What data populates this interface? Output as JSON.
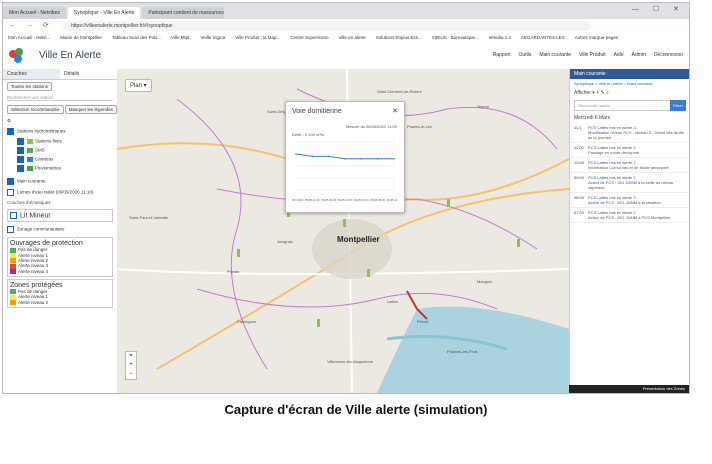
{
  "browser": {
    "tabs": [
      "Mon Accueil - Netvibes",
      "Synoptique - Ville En Alerte",
      "Participant contient de ressources"
    ],
    "url": "https://villeenalerte.montpellier.fr/#/synoptique",
    "bookmarks": [
      "Mon Accueil - Netvi...",
      "Mairie de Montpellier",
      "Tableau Suivi des Pols...",
      "Ville Mtpl.",
      "Veille Sigma",
      "Ville Produit : la Map...",
      "Centre Supervision",
      "Ville en alerte",
      "Solutions Enjeux Ess...",
      "SIRIUS - Bureautique...",
      "eMedia 1.4",
      "AEGARDANTES LES",
      "Autres marque-pages"
    ],
    "window_controls": "— ☐ ✕"
  },
  "app": {
    "title": "Ville En Alerte",
    "toolbar": [
      "Rapport",
      "Outils",
      "Main courante",
      "Ville Produit",
      "Aide",
      "Admin",
      "Déconnexion"
    ]
  },
  "left_panel": {
    "tabs": [
      "Couches",
      "Détails"
    ],
    "dropdown": "Toutes les stations",
    "search_placeholder": "Rechercher une station",
    "buttons": [
      "Sélection recommandée",
      "Masquer les légendes"
    ],
    "section_title": "Stations hydrométriques",
    "station_types": [
      "Stations fixes",
      "SMS",
      "Caméras",
      "Pluviomètres"
    ],
    "layers": [
      "Main courante",
      "Lames d'eau radar (06/05/2020 11:10)"
    ],
    "group_title": "Couches thématiques",
    "sub_layers": [
      "Lit Mineur",
      "Zonage communautaire"
    ],
    "protection_title": "Ouvrages de protection",
    "protection_legend": [
      {
        "label": "Pas de danger",
        "color": "#4caf50"
      },
      {
        "label": "Alerte niveau 1",
        "color": "#ffeb3b"
      },
      {
        "label": "Alerte niveau 2",
        "color": "#ff9800"
      },
      {
        "label": "Alerte niveau 3",
        "color": "#f44336"
      },
      {
        "label": "Alerte niveau 4",
        "color": "#9c27b0"
      }
    ],
    "zones_title": "Zones protégées",
    "zones_legend": [
      {
        "label": "Pas de danger",
        "color": "#4caf50"
      },
      {
        "label": "Alerte niveau 1",
        "color": "#ffeb3b"
      },
      {
        "label": "Alerte niveau 2",
        "color": "#ff9800"
      }
    ]
  },
  "map": {
    "mode": "Plan",
    "city": "Montpellier",
    "zoom_controls": [
      "⌖",
      "+",
      "−"
    ],
    "labels": [
      {
        "text": "Saint-Gély-du-Fesc"
      },
      {
        "text": "Saint-Clément-de-Rivière"
      },
      {
        "text": "Prades-le-Lez"
      },
      {
        "text": "Teyran"
      },
      {
        "text": "Saint-Paul-et-Valmalle"
      },
      {
        "text": "Juvignac"
      },
      {
        "text": "Pignan"
      },
      {
        "text": "Lattes"
      },
      {
        "text": "Mauguio"
      },
      {
        "text": "Palavas-les-Flots"
      },
      {
        "text": "Pérols"
      },
      {
        "text": "Fabrègues"
      },
      {
        "text": "Villeneuve-lès-Maguelone"
      }
    ]
  },
  "popup": {
    "title": "Voie domitienne",
    "date": "Mesure du 06/05/2020 11:00",
    "legend": "Débit - 0,103 m³/s",
    "close": "✕"
  },
  "chart_data": {
    "type": "line",
    "title": "Voie domitienne",
    "xlabel": "",
    "ylabel": "",
    "x": [
      "05/05 18:00",
      "05/05 21:00",
      "06/05 00:00",
      "06/05 03:00",
      "06/05 06:00",
      "06/05 09:00",
      "06/05 11:00"
    ],
    "series": [
      {
        "name": "Débit",
        "values": [
          0.105,
          0.104,
          0.104,
          0.103,
          0.103,
          0.103,
          0.103
        ]
      }
    ],
    "ylim": [
      0.09,
      0.11
    ]
  },
  "right_panel": {
    "header": "Main courante",
    "subtitle": "Synoptique > Ville en alerte > Main courante",
    "toolbar": "Afficher ▾   +   ✎   ⌕",
    "search_placeholder": "Recherche rapide",
    "search_button": "Filtrer",
    "day": "Mercredi 6 Mars",
    "entries": [
      {
        "time": "11:1",
        "link": "PCS Lattes mis en alerte 3",
        "detail": "Modification niveau PCS - Niveau 3 - Début des droits de la journée"
      },
      {
        "time": "11:00",
        "link": "PCS Lattes mis en alerte 2",
        "detail": "Passage en mode décorporé"
      },
      {
        "time": "10:00",
        "link": "PCS Lattes mis en alerte 2",
        "detail": "Information Cumul eau et de Mode décorporé"
      },
      {
        "time": "09:00",
        "link": "PCS Lattes mis en alerte 2",
        "detail": "Action de PCS : SIG JUMM à la veille du niveau supérieur"
      },
      {
        "time": "08:00",
        "link": "PCS Lattes mis en alerte 2",
        "detail": "Action de PCS : DIG JUMM à la situation"
      },
      {
        "time": "07:00",
        "link": "PCS Lattes mis en alerte 2",
        "detail": "Action de PCS : DIG JUMM à PCS Montpellier"
      }
    ],
    "taskbar": "Présentation des Zones"
  },
  "caption": "Capture d'écran de Ville alerte (simulation)"
}
